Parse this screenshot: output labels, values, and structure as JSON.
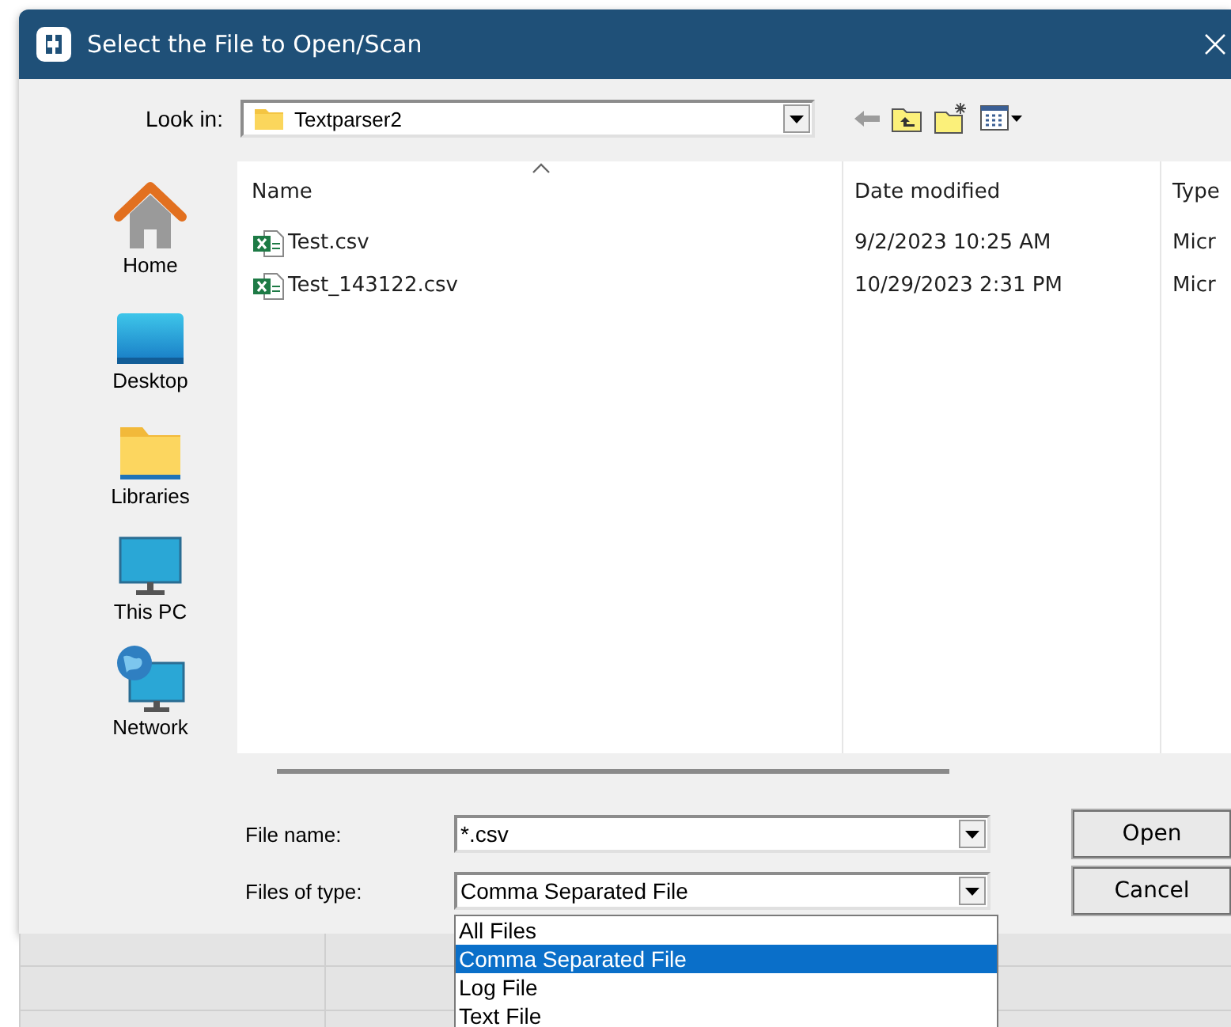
{
  "window": {
    "title": "Select the File to Open/Scan"
  },
  "look_in": {
    "label": "Look in:",
    "value": "Textparser2"
  },
  "places": [
    {
      "label": "Home",
      "kind": "home"
    },
    {
      "label": "Desktop",
      "kind": "desktop"
    },
    {
      "label": "Libraries",
      "kind": "libraries"
    },
    {
      "label": "This PC",
      "kind": "pc"
    },
    {
      "label": "Network",
      "kind": "network"
    }
  ],
  "file_list": {
    "columns": [
      "Name",
      "Date modified",
      "Type"
    ],
    "rows": [
      {
        "name": "Test.csv",
        "date_modified": "9/2/2023 10:25 AM",
        "type": "Micr"
      },
      {
        "name": "Test_143122.csv",
        "date_modified": "10/29/2023 2:31 PM",
        "type": "Micr"
      }
    ]
  },
  "file_name": {
    "label": "File name:",
    "value": "*.csv"
  },
  "file_type": {
    "label": "Files of type:",
    "value": "Comma Separated File",
    "options": [
      {
        "label": "All Files",
        "selected": false
      },
      {
        "label": "Comma Separated File",
        "selected": true
      },
      {
        "label": "Log File",
        "selected": false
      },
      {
        "label": "Text File",
        "selected": false
      }
    ]
  },
  "buttons": [
    "Open",
    "Cancel"
  ]
}
